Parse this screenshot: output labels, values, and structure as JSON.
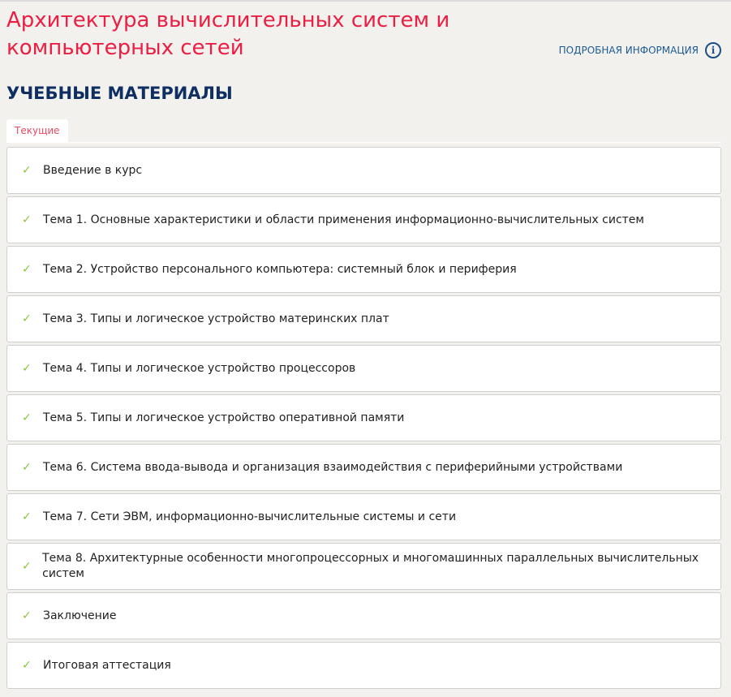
{
  "header": {
    "title": "Архитектура вычислительных систем и компьютерных сетей",
    "info_link": "ПОДРОБНАЯ ИНФОРМАЦИЯ",
    "info_icon": "info-icon"
  },
  "section": {
    "title": "УЧЕБНЫЕ МАТЕРИАЛЫ",
    "tab": "Текущие"
  },
  "colors": {
    "accent": "#ea1f43",
    "heading": "#0f2f63",
    "check": "#8cc43f",
    "background": "#f2f1ee"
  },
  "items": [
    {
      "label": "Введение в курс",
      "status": "completed"
    },
    {
      "label": "Тема 1. Основные характеристики и области применения информационно-вычислительных систем",
      "status": "completed"
    },
    {
      "label": "Тема 2. Устройство персонального компьютера: системный блок и периферия",
      "status": "completed"
    },
    {
      "label": "Тема 3. Типы и логическое устройство материнских плат",
      "status": "completed"
    },
    {
      "label": "Тема 4. Типы и логическое устройство процессоров",
      "status": "completed"
    },
    {
      "label": "Тема 5. Типы и логическое устройство оперативной памяти",
      "status": "completed"
    },
    {
      "label": "Тема 6. Система ввода-вывода и организация взаимодействия с периферийными устройствами",
      "status": "completed"
    },
    {
      "label": "Тема 7. Сети ЭВМ, информационно-вычислительные системы и сети",
      "status": "completed"
    },
    {
      "label": "Тема 8. Архитектурные особенности многопроцессорных и многомашинных параллельных вычислительных систем",
      "status": "completed"
    },
    {
      "label": "Заключение",
      "status": "completed"
    },
    {
      "label": "Итоговая аттестация",
      "status": "completed"
    }
  ]
}
